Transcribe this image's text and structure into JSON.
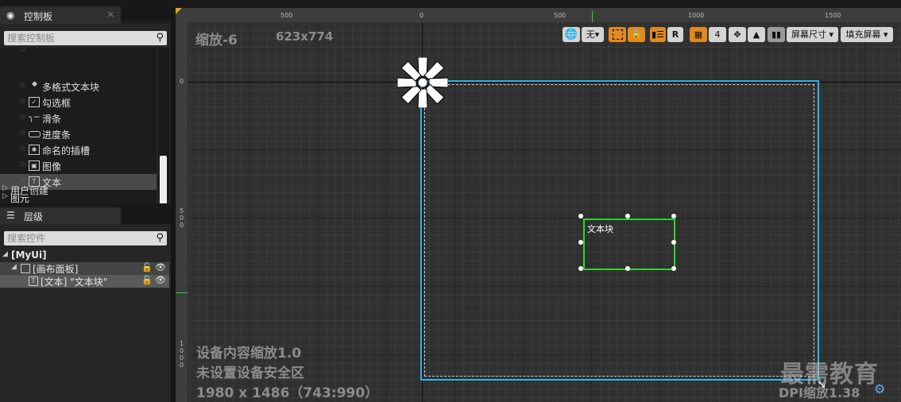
{
  "palette": {
    "tab_title": "控制板",
    "search_placeholder": "搜索控制板",
    "items": [
      {
        "label": "多格式文本块",
        "icon": "rich-text-icon"
      },
      {
        "label": "勾选框",
        "icon": "checkbox-icon"
      },
      {
        "label": "滑条",
        "icon": "slider-icon"
      },
      {
        "label": "进度条",
        "icon": "progress-bar-icon"
      },
      {
        "label": "命名的插槽",
        "icon": "named-slot-icon"
      },
      {
        "label": "图像",
        "icon": "image-icon"
      },
      {
        "label": "文本",
        "icon": "text-icon"
      }
    ],
    "categories": [
      {
        "label": "图元"
      },
      {
        "label": "用户创建"
      }
    ]
  },
  "hierarchy": {
    "tab_title": "层级",
    "search_placeholder": "搜索控件",
    "root": "[MyUi]",
    "canvas_panel": "[画布面板]",
    "text_item": "[文本] \"文本块\""
  },
  "designer": {
    "zoom_label": "缩放-6",
    "resolution": "623x774",
    "ruler_top": [
      "500",
      "0",
      "500",
      "1000",
      "1500"
    ],
    "ruler_left": [
      "0",
      "5\n0\n0",
      "1\n0\n0\n0"
    ],
    "toolbar": {
      "none_label": "无",
      "r_label": "R",
      "grid_size": "4",
      "screen_size_label": "屏幕尺寸",
      "fill_screen_label": "填充屏幕"
    },
    "text_block_label": "文本块",
    "device_scale": "设备内容缩放1.0",
    "safe_zone": "未设置设备安全区",
    "device_resolution": "1980 x 1486（743:990）",
    "dpi_scale": "DPI缩放1.38",
    "watermark": "最需教育"
  },
  "colors": {
    "accent_orange": "#e08a1e",
    "selection_green": "#2bd62b",
    "canvas_outline": "#2bb6e8"
  }
}
